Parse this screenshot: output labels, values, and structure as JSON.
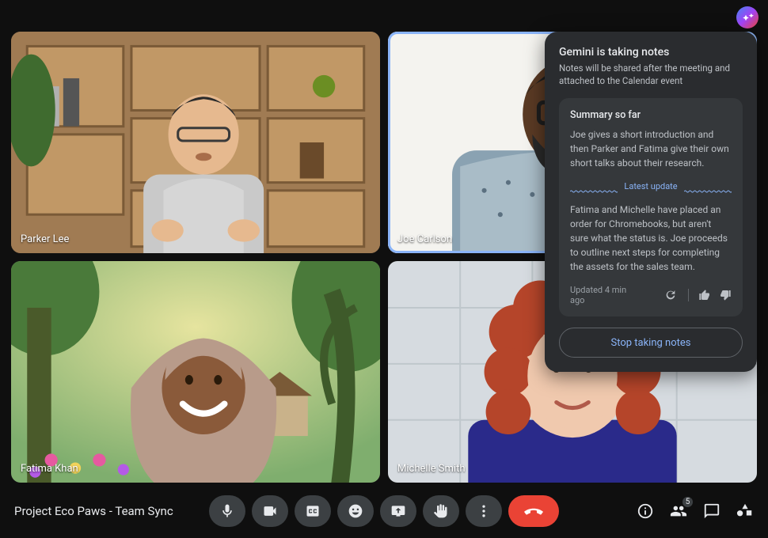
{
  "meeting": {
    "title": "Project Eco Paws - Team Sync",
    "participant_count": 5
  },
  "participants": [
    {
      "name": "Parker Lee",
      "speaking": false
    },
    {
      "name": "Joe Carlson",
      "speaking": true
    },
    {
      "name": "Fatima Khan",
      "speaking": false
    },
    {
      "name": "Michelle Smith",
      "speaking": false
    }
  ],
  "notes_panel": {
    "title": "Gemini is taking notes",
    "subtitle": "Notes will be shared after the meeting and attached to the Calendar event",
    "summary_heading": "Summary so far",
    "summary_text": "Joe gives a short introduction and then Parker and Fatima give their own short talks about their research.",
    "divider_label": "Latest update",
    "update_text": "Fatima and Michelle have placed an order for Chromebooks, but aren't sure what the status is. Joe proceeds to outline next steps for completing the assets for the sales team.",
    "updated_label": "Updated 4 min ago",
    "stop_button": "Stop taking notes"
  },
  "controls": {
    "mic": "microphone",
    "camera": "camera",
    "captions": "captions",
    "emoji": "reactions",
    "present": "present-screen",
    "raise_hand": "raise-hand",
    "more": "more-options",
    "hangup": "leave-call"
  }
}
